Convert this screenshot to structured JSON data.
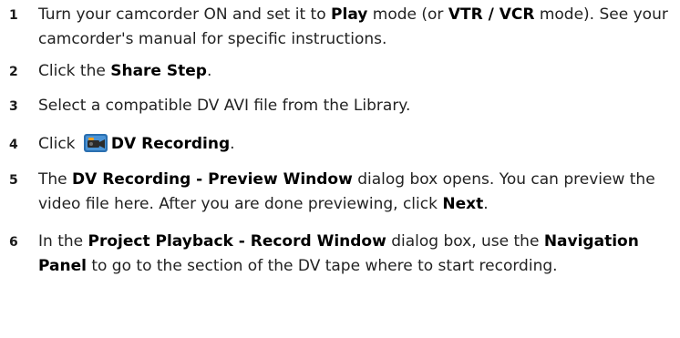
{
  "steps": [
    {
      "n": "1",
      "a": "Turn your camcorder ON and set it to ",
      "b": "Play",
      "c": " mode (or ",
      "d": "VTR / VCR",
      "e": " mode). See your camcorder's manual for specific instructions."
    },
    {
      "n": "2",
      "a": "Click the ",
      "b": "Share Step",
      "c": "."
    },
    {
      "n": "3",
      "a": "Select a compatible DV AVI file from the Library."
    },
    {
      "n": "4",
      "a": "Click ",
      "icon": "camcorder-icon",
      "b": "DV Recording",
      "c": "."
    },
    {
      "n": "5",
      "a": "The ",
      "b": "DV Recording - Preview Window",
      "c": " dialog box opens. You can preview the video file here. After you are done previewing, click ",
      "d": "Next",
      "e": "."
    },
    {
      "n": "6",
      "a": "In the ",
      "b": "Project Playback - Record Window",
      "c": " dialog box, use the ",
      "d": "Navigation Panel",
      "e": " to go to the section of the DV tape where to start recording."
    }
  ]
}
